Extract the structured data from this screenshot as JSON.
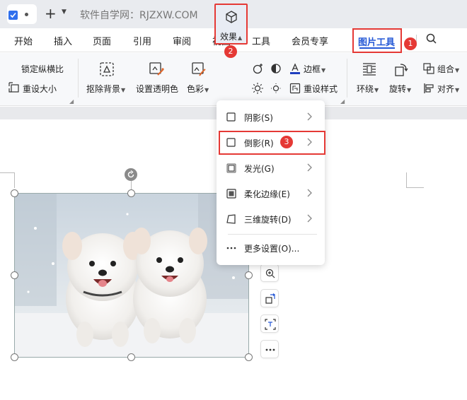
{
  "titlebar": {
    "site_title": "软件自学网：RJZXW.COM"
  },
  "menu": {
    "tabs": [
      "开始",
      "插入",
      "页面",
      "引用",
      "审阅",
      "视图",
      "工具",
      "会员专享"
    ],
    "active_tab": "图片工具"
  },
  "ribbon": {
    "lock_ratio": "锁定纵横比",
    "lock_ratio_checked": true,
    "resize": "重设大小",
    "remove_bg": "抠除背景",
    "set_transparent": "设置透明色",
    "color": "色彩",
    "effect": "效果",
    "border": "边框",
    "reset_style": "重设样式",
    "wrap": "环绕",
    "rotate": "旋转",
    "group": "组合",
    "align": "对齐"
  },
  "badges": {
    "one": "1",
    "two": "2",
    "three": "3"
  },
  "effects_menu": {
    "items": [
      {
        "label": "阴影(S)",
        "icon": "shadow-icon",
        "has_submenu": true
      },
      {
        "label": "倒影(R)",
        "icon": "reflection-icon",
        "has_submenu": true
      },
      {
        "label": "发光(G)",
        "icon": "glow-icon",
        "has_submenu": true
      },
      {
        "label": "柔化边缘(E)",
        "icon": "soft-edge-icon",
        "has_submenu": true
      },
      {
        "label": "三维旋转(D)",
        "icon": "3d-rotate-icon",
        "has_submenu": true
      }
    ],
    "more": "更多设置(O)..."
  },
  "side_tools": [
    "zoom-in-icon",
    "replace-image-icon",
    "crop-icon",
    "more-icon"
  ],
  "colors": {
    "accent_blue": "#2458d6",
    "highlight_red": "#e53935",
    "checkbox_blue": "#2f6fed"
  }
}
